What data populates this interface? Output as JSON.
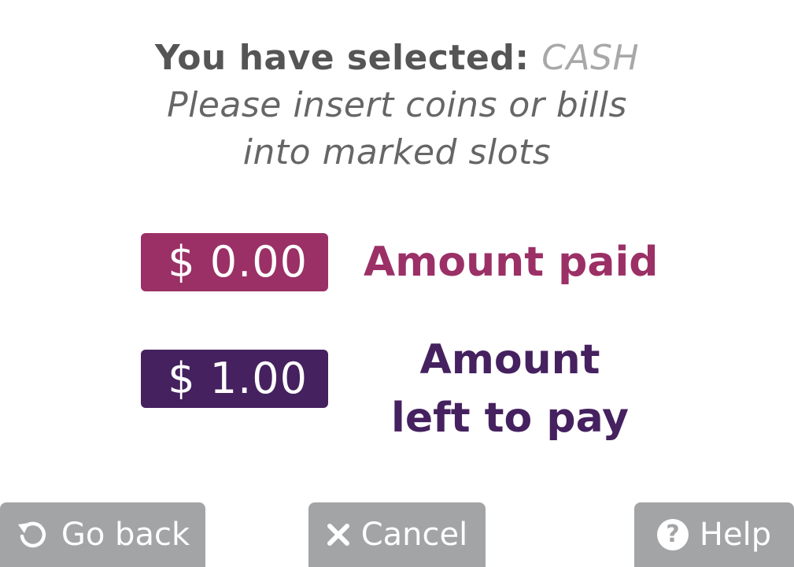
{
  "header": {
    "selected_prefix": "You have selected:",
    "payment_method": "CASH",
    "instruction_line1": "Please insert coins or bills",
    "instruction_line2": "into marked slots"
  },
  "amounts": {
    "paid_value": "$ 0.00",
    "paid_label": "Amount paid",
    "left_value": "$ 1.00",
    "left_label": "Amount left to pay"
  },
  "buttons": {
    "back_label": "Go back",
    "cancel_label": "Cancel",
    "help_label": "Help",
    "help_icon_glyph": "?"
  },
  "icons": {
    "back": "refresh-arrow-icon",
    "cancel": "x-icon",
    "help": "question-circle-icon"
  },
  "colors": {
    "paid_accent": "#9b3066",
    "left_accent": "#45215f",
    "button_bg": "#a3a4a6",
    "method_text": "#a8a8a8"
  }
}
